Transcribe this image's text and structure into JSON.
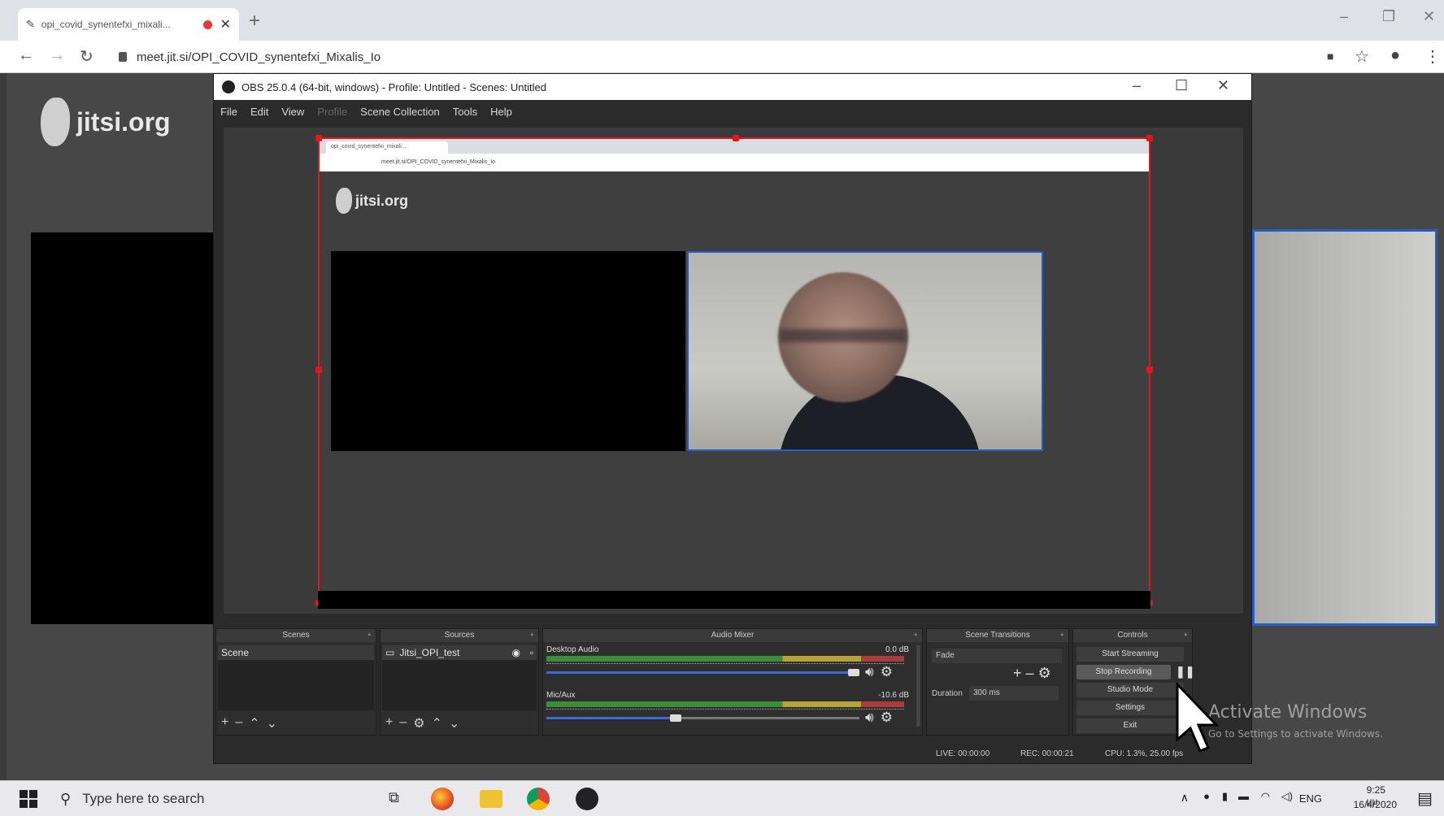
{
  "browser": {
    "tab": {
      "title": "opi_covid_synentefxi_mixali..."
    },
    "address": "meet.jit.si/OPI_COVID_synentefxi_Mixalis_Io"
  },
  "jitsi": {
    "logo": "jitsi.org"
  },
  "obs": {
    "title": "OBS 25.0.4 (64-bit, windows) - Profile: Untitled - Scenes: Untitled",
    "menu": [
      "File",
      "Edit",
      "View",
      "Profile",
      "Scene Collection",
      "Tools",
      "Help"
    ],
    "docks": {
      "scenes": {
        "title": "Scenes",
        "items": [
          "Scene"
        ]
      },
      "sources": {
        "title": "Sources",
        "items": [
          "Jitsi_OPI_test"
        ]
      },
      "mixer": {
        "title": "Audio Mixer",
        "channels": [
          {
            "name": "Desktop Audio",
            "db": "0.0 dB",
            "volume": 1.0
          },
          {
            "name": "Mic/Aux",
            "db": "-10.6 dB",
            "volume": 0.43
          }
        ]
      },
      "transitions": {
        "title": "Scene Transitions",
        "selected": "Fade",
        "duration_label": "Duration",
        "duration_value": "300 ms"
      },
      "controls": {
        "title": "Controls",
        "buttons": [
          "Start Streaming",
          "Stop Recording",
          "Studio Mode",
          "Settings",
          "Exit"
        ]
      }
    },
    "status": {
      "live": "LIVE: 00:00:00",
      "rec": "REC: 00:00:21",
      "cpu": "CPU: 1.3%, 25.00 fps"
    }
  },
  "watermark": {
    "line1": "Activate Windows",
    "line2": "Go to Settings to activate Windows."
  },
  "taskbar": {
    "search_placeholder": "Type here to search",
    "lang": "ENG",
    "time": "9:25 μμ",
    "date": "16/4/2020"
  },
  "colors": {
    "selection": "#e0181e",
    "active_speaker": "#2a5bc2",
    "obs_bg": "#2b2b2b"
  }
}
